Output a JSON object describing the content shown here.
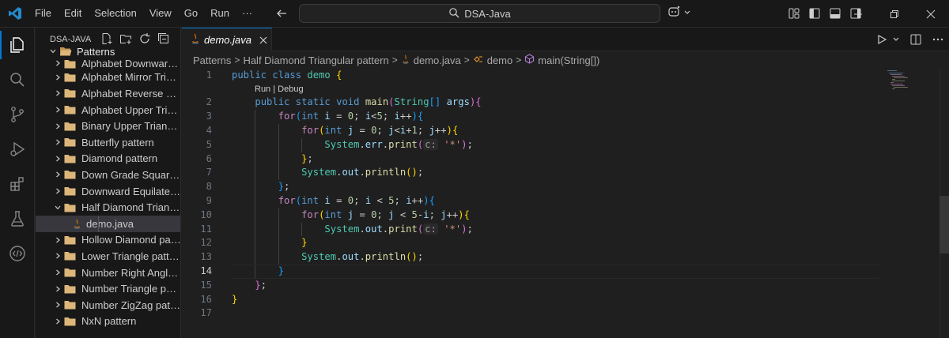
{
  "titlebar": {
    "menu": [
      "File",
      "Edit",
      "Selection",
      "View",
      "Go",
      "Run",
      "···"
    ],
    "search_text": "DSA-Java"
  },
  "explorer": {
    "title": "DSA-JAVA",
    "root_folder": "Patterns",
    "items": [
      "Alphabet Downward ...",
      "Alphabet Mirror Trian...",
      "Alphabet Reverse Rig...",
      "Alphabet Upper Trian...",
      "Binary Upper Triangul...",
      "Butterfly pattern",
      "Diamond pattern",
      "Down Grade Square ...",
      "Downward Equilateral...",
      "Half Diamond Triangu...",
      "demo.java",
      "Hollow Diamond patt...",
      "Lower Triangle pattern",
      "Number Right Angle ...",
      "Number Triangle patt...",
      "Number ZigZag patte...",
      "NxN pattern"
    ]
  },
  "editor": {
    "tab_label": "demo.java",
    "breadcrumb": [
      "Patterns",
      "Half Diamond Triangular pattern",
      "demo.java",
      "demo",
      "main(String[])"
    ],
    "codelens": "Run | Debug",
    "current_line": "14",
    "line_numbers": [
      "1",
      "2",
      "3",
      "4",
      "5",
      "6",
      "7",
      "8",
      "9",
      "10",
      "11",
      "12",
      "13",
      "14",
      "15",
      "16",
      "17"
    ]
  },
  "colors": {
    "accent": "#0078d4",
    "background": "#1f1f1f",
    "keyword": "#569cd6",
    "control": "#c586c0",
    "string": "#ce9178"
  }
}
